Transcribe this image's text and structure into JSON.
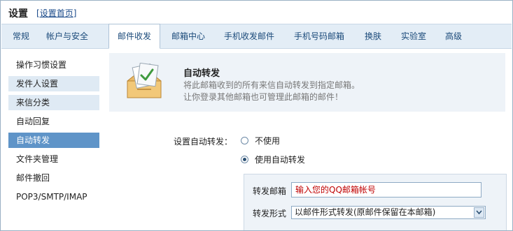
{
  "header": {
    "title": "设置",
    "home_link_open": "[",
    "home_link": "设置首页",
    "home_link_close": "]"
  },
  "tabs": [
    {
      "label": "常规"
    },
    {
      "label": "帐户与安全"
    },
    {
      "label": "邮件收发",
      "active": true
    },
    {
      "label": "邮箱中心"
    },
    {
      "label": "手机收发邮件"
    },
    {
      "label": "手机号码邮箱"
    },
    {
      "label": "换肤"
    },
    {
      "label": "实验室"
    },
    {
      "label": "高级"
    }
  ],
  "sidebar": {
    "items": [
      {
        "label": "操作习惯设置"
      },
      {
        "label": "发件人设置"
      },
      {
        "label": "来信分类"
      },
      {
        "label": "自动回复"
      },
      {
        "label": "自动转发",
        "active": true
      },
      {
        "label": "文件夹管理"
      },
      {
        "label": "邮件撤回"
      },
      {
        "label": "POP3/SMTP/IMAP"
      }
    ]
  },
  "banner": {
    "icon": "mailbox-forward-icon",
    "title": "自动转发",
    "desc_line1": "将此邮箱收到的所有来信自动转发到指定邮箱。",
    "desc_line2": "让你登录其他邮箱也可管理此邮箱的邮件！"
  },
  "forward_setting": {
    "label": "设置自动转发：",
    "options": [
      {
        "label": "不使用",
        "selected": false
      },
      {
        "label": "使用自动转发",
        "selected": true
      }
    ]
  },
  "forward_form": {
    "address_label": "转发邮箱",
    "address_placeholder": "输入您的QQ邮箱帐号",
    "mode_label": "转发形式",
    "mode_value": "以邮件形式转发(原邮件保留在本邮箱)"
  },
  "colors": {
    "accent": "#5f94c8",
    "tab_bar": "#e3edf6",
    "panel_bg": "#eef3f8",
    "placeholder_red": "#c00000"
  }
}
